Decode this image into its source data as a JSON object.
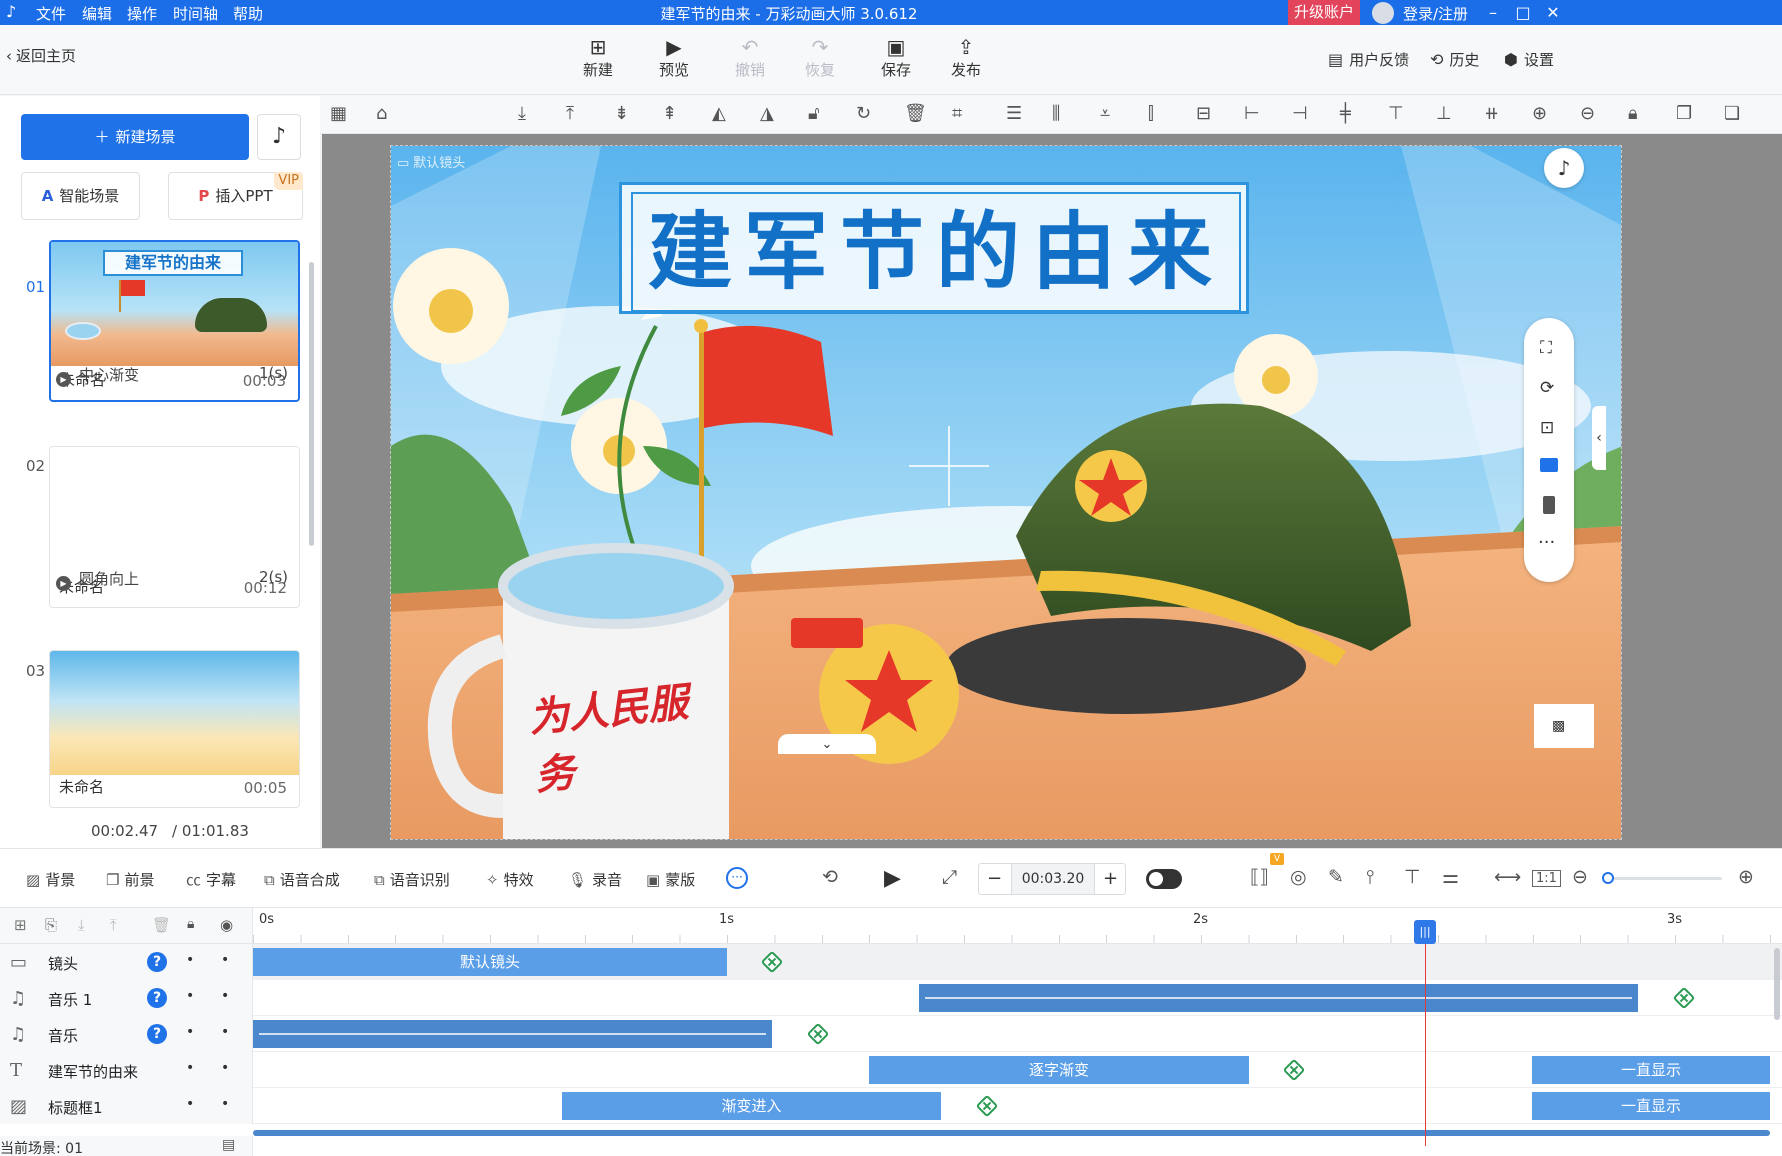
{
  "app": {
    "title": "建军节的由来 - 万彩动画大师 3.0.612",
    "menu": [
      "文件",
      "编辑",
      "操作",
      "时间轴",
      "帮助"
    ],
    "upgrade": "升级账户",
    "login": "登录/注册"
  },
  "toolbar": {
    "back": "返回主页",
    "buttons": [
      {
        "label": "新建",
        "icon": "plus-square-icon"
      },
      {
        "label": "预览",
        "icon": "play-icon"
      },
      {
        "label": "撤销",
        "icon": "undo-icon"
      },
      {
        "label": "恢复",
        "icon": "redo-icon"
      },
      {
        "label": "保存",
        "icon": "save-icon"
      },
      {
        "label": "发布",
        "icon": "publish-icon"
      }
    ],
    "right": [
      {
        "label": "用户反馈",
        "icon": "feedback-icon"
      },
      {
        "label": "历史",
        "icon": "history-icon"
      },
      {
        "label": "设置",
        "icon": "gear-icon"
      }
    ]
  },
  "left": {
    "new_scene": "新建场景",
    "smart_scene": "智能场景",
    "insert_ppt": "插入PPT",
    "vip": "VIP",
    "scenes": [
      {
        "num": "01",
        "name": "未命名",
        "duration": "00:03",
        "thumb_title": "建军节的由来"
      },
      {
        "num": "02",
        "name": "未命名",
        "duration": "00:12"
      },
      {
        "num": "03",
        "name": "未命名",
        "duration": "00:05"
      }
    ],
    "transitions": [
      {
        "name": "中心渐变",
        "value": "1(s)"
      },
      {
        "name": "圆角向上",
        "value": "2(s)"
      }
    ],
    "time_current": "00:02.47",
    "time_total": "/ 01:01.83"
  },
  "canvas": {
    "camera_label": "默认镜头",
    "title_text": "建军节的由来",
    "cup_text": "为人民服务"
  },
  "controls": {
    "left_buttons": [
      "背景",
      "前景",
      "字幕",
      "语音合成",
      "语音识别",
      "特效",
      "录音",
      "蒙版"
    ],
    "time": "00:03.20"
  },
  "timeline": {
    "ruler": [
      "0s",
      "1s",
      "2s",
      "3s"
    ],
    "tracks": [
      {
        "name": "镜头",
        "icon": "camera-icon",
        "help": "?",
        "clips": [
          {
            "text": "默认镜头"
          }
        ]
      },
      {
        "name": "音乐 1",
        "icon": "music-note-icon",
        "help": "?",
        "clips": []
      },
      {
        "name": "音乐",
        "icon": "music-note-icon",
        "help": "?",
        "clips": []
      },
      {
        "name": "建军节的由来",
        "icon": "text-icon",
        "clips": [
          {
            "text": "逐字渐变"
          },
          {
            "text": "一直显示"
          }
        ]
      },
      {
        "name": "标题框1",
        "icon": "image-icon",
        "clips": [
          {
            "text": "渐变进入"
          },
          {
            "text": "一直显示"
          }
        ]
      }
    ],
    "current_scene": "当前场景: 01"
  }
}
